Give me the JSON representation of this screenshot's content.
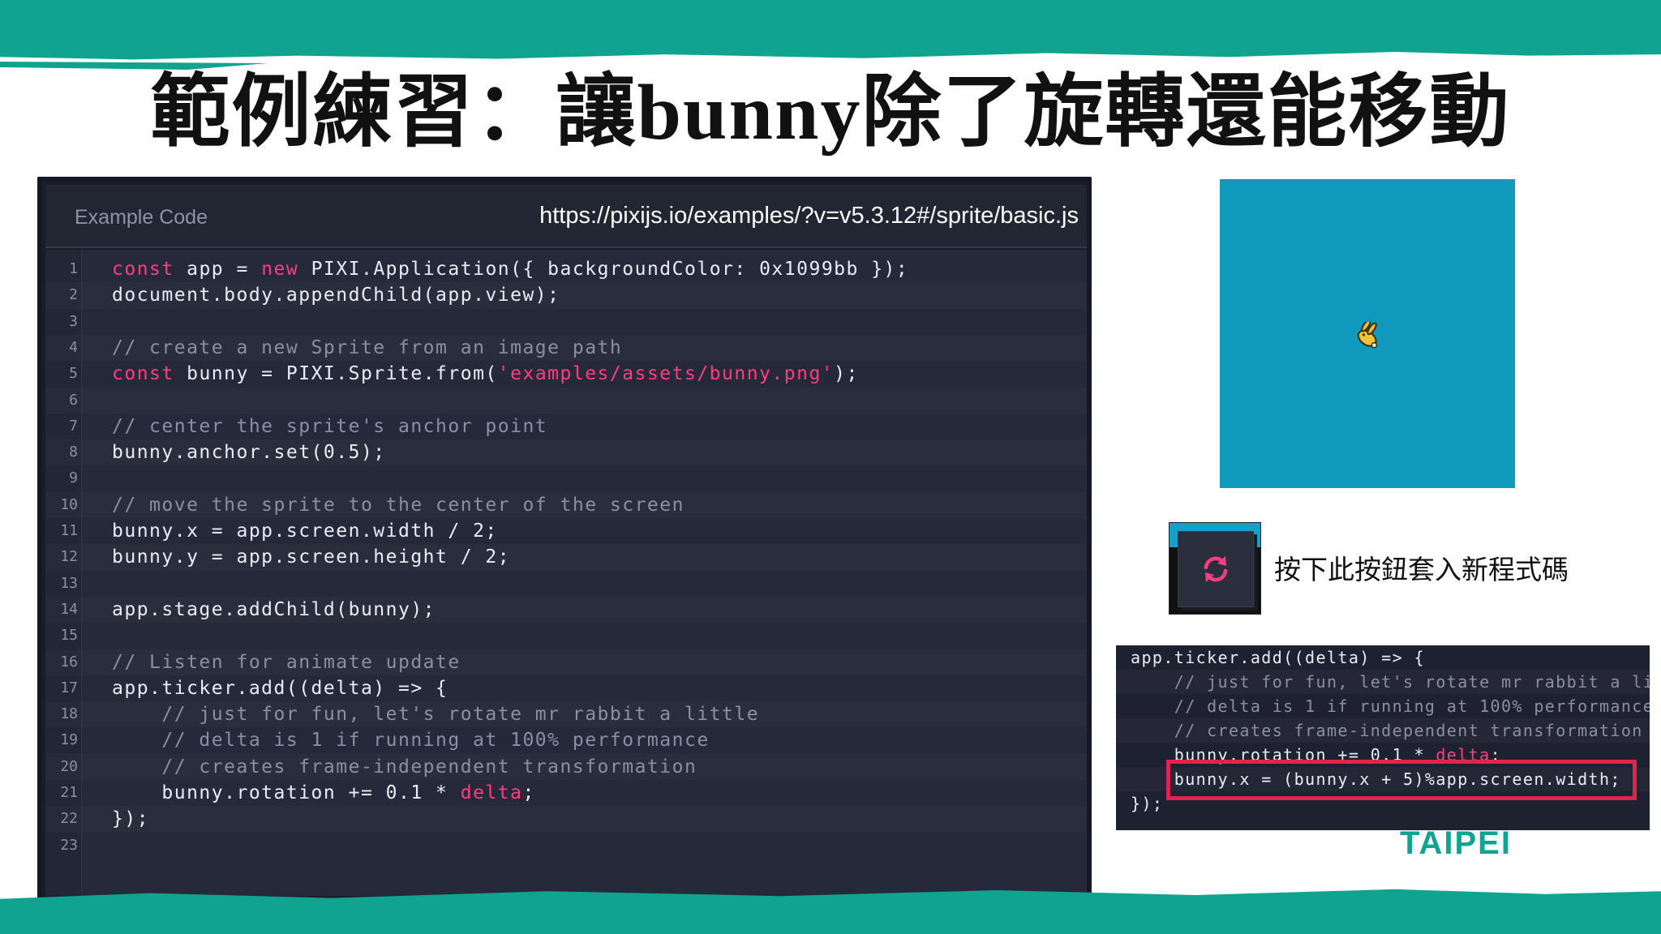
{
  "slide": {
    "title": "範例練習：讓bunny除了旋轉還能移動",
    "button_note": "按下此按鈕套入新程式碼",
    "footer_logo": "TAIPEI",
    "colors": {
      "teal": "#10a38f",
      "preview_bg": "#1099bb",
      "highlight": "#e0244e",
      "keyword": "#ff3d7f"
    }
  },
  "code_panel": {
    "header_title": "Example Code",
    "url": "https://pixijs.io/examples/?v=v5.3.12#/sprite/basic.js",
    "lines": [
      {
        "n": "1",
        "parts": [
          {
            "t": "const",
            "c": "kw"
          },
          {
            "t": " app = "
          },
          {
            "t": "new",
            "c": "kw"
          },
          {
            "t": " PIXI.Application({ backgroundColor: 0x1099bb });"
          }
        ]
      },
      {
        "n": "2",
        "parts": [
          {
            "t": "document.body.appendChild(app.view);"
          }
        ]
      },
      {
        "n": "3",
        "parts": []
      },
      {
        "n": "4",
        "parts": [
          {
            "t": "// create a new Sprite from an image path",
            "c": "cm"
          }
        ]
      },
      {
        "n": "5",
        "parts": [
          {
            "t": "const",
            "c": "kw"
          },
          {
            "t": " bunny = PIXI.Sprite.from("
          },
          {
            "t": "'examples/assets/bunny.png'",
            "c": "st"
          },
          {
            "t": ");"
          }
        ]
      },
      {
        "n": "6",
        "parts": []
      },
      {
        "n": "7",
        "parts": [
          {
            "t": "// center the sprite's anchor point",
            "c": "cm"
          }
        ]
      },
      {
        "n": "8",
        "parts": [
          {
            "t": "bunny.anchor.set(0.5);"
          }
        ]
      },
      {
        "n": "9",
        "parts": []
      },
      {
        "n": "10",
        "parts": [
          {
            "t": "// move the sprite to the center of the screen",
            "c": "cm"
          }
        ]
      },
      {
        "n": "11",
        "parts": [
          {
            "t": "bunny.x = app.screen.width / 2;"
          }
        ]
      },
      {
        "n": "12",
        "parts": [
          {
            "t": "bunny.y = app.screen.height / 2;"
          }
        ]
      },
      {
        "n": "13",
        "parts": []
      },
      {
        "n": "14",
        "parts": [
          {
            "t": "app.stage.addChild(bunny);"
          }
        ]
      },
      {
        "n": "15",
        "parts": []
      },
      {
        "n": "16",
        "parts": [
          {
            "t": "// Listen for animate update",
            "c": "cm"
          }
        ]
      },
      {
        "n": "17",
        "parts": [
          {
            "t": "app.ticker.add((delta) => {"
          }
        ]
      },
      {
        "n": "18",
        "parts": [
          {
            "t": "    // just for fun, let's rotate mr rabbit a little",
            "c": "cm"
          }
        ]
      },
      {
        "n": "19",
        "parts": [
          {
            "t": "    // delta is 1 if running at 100% performance",
            "c": "cm"
          }
        ]
      },
      {
        "n": "20",
        "parts": [
          {
            "t": "    // creates frame-independent transformation",
            "c": "cm"
          }
        ]
      },
      {
        "n": "21",
        "parts": [
          {
            "t": "    bunny.rotation += 0.1 * "
          },
          {
            "t": "delta",
            "c": "kw"
          },
          {
            "t": ";"
          }
        ]
      },
      {
        "n": "22",
        "parts": [
          {
            "t": "});"
          }
        ]
      },
      {
        "n": "23",
        "parts": []
      }
    ]
  },
  "snippet": {
    "lines": [
      {
        "parts": [
          {
            "t": "app.ticker.add((delta) => {"
          }
        ]
      },
      {
        "parts": [
          {
            "t": "    // just for fun, let's rotate mr rabbit a li",
            "c": "cm"
          }
        ]
      },
      {
        "parts": [
          {
            "t": "    // delta is 1 if running at 100% performance",
            "c": "cm"
          }
        ]
      },
      {
        "parts": [
          {
            "t": "    // creates frame-independent transformation",
            "c": "cm"
          }
        ]
      },
      {
        "parts": [
          {
            "t": "    bunny.rotation += 0.1 * "
          },
          {
            "t": "delta",
            "c": "kw"
          },
          {
            "t": ";"
          }
        ]
      },
      {
        "parts": [
          {
            "t": "    bunny.x = (bunny.x + 5)%app.screen.width;"
          }
        ]
      },
      {
        "parts": [
          {
            "t": "});"
          }
        ]
      }
    ]
  }
}
